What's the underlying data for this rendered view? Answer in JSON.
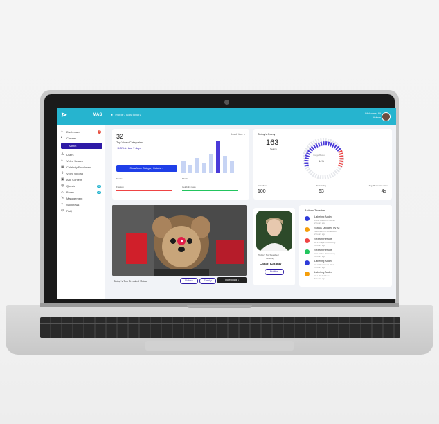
{
  "header": {
    "logo_glyph": "⋗",
    "brand": "MAS",
    "breadcrumb": "■  |  Home  /  Dashboard",
    "user_name": "Welcome, Ali",
    "user_role": "Admin"
  },
  "sidebar": {
    "items": [
      {
        "label": "Dashboard",
        "icon": "home-icon",
        "glyph": "⌂",
        "badge": "2"
      },
      {
        "label": "Classes",
        "icon": "dot-icon",
        "glyph": "•"
      },
      {
        "label": "Admin",
        "icon": "dot-icon",
        "glyph": "•",
        "active": true
      },
      {
        "label": "Users",
        "icon": "user-icon",
        "glyph": "♙"
      },
      {
        "label": "Video Search",
        "icon": "search-icon",
        "glyph": "⌕"
      },
      {
        "label": "Celebrity Enrollment",
        "icon": "grid-icon",
        "glyph": "▦"
      },
      {
        "label": "Video Upload",
        "icon": "upload-icon",
        "glyph": "⇪"
      },
      {
        "label": "Add Content",
        "icon": "add-icon",
        "glyph": "▣"
      },
      {
        "label": "Quests",
        "icon": "clock-icon",
        "glyph": "◷",
        "pill": "9"
      },
      {
        "label": "Boxes",
        "icon": "warning-icon",
        "glyph": "△",
        "pill": "4"
      },
      {
        "label": "Management",
        "icon": "pen-icon",
        "glyph": "✎"
      },
      {
        "label": "Workflows",
        "icon": "flow-icon",
        "glyph": "⟡"
      },
      {
        "label": "FAQ",
        "icon": "help-icon",
        "glyph": "⊙"
      }
    ]
  },
  "top_card": {
    "count": "32",
    "title": "Top Video Categories",
    "growth": "+4.3% in last 7 days",
    "range": "Last Year ▾",
    "button": "Show More Category Details  →",
    "legend": [
      "Sports",
      "Shorts",
      "Fashion",
      "Celebrity news"
    ],
    "legend_colors": [
      "#4b3bd9",
      "#f59e0b",
      "#ef4444",
      "#22c55e"
    ],
    "bar_levels": [
      0.35,
      0.25,
      0.45,
      0.3,
      0.55,
      0.95,
      0.5,
      0.35
    ]
  },
  "queries": {
    "title": "Today's Query",
    "value": "163",
    "value_sub": "Search",
    "gauge_label": "Image Based",
    "gauge_value": "64%",
    "stats": [
      {
        "label": "Scheduled",
        "value": "100"
      },
      {
        "label": "Processing",
        "value": "63"
      },
      {
        "label": "Avg. Response Time",
        "value": "4s"
      }
    ]
  },
  "video": {
    "caption": "Today's Top Trended Video",
    "tags": [
      "Nature",
      "Family"
    ],
    "download": "Download  ⤓"
  },
  "person": {
    "caption_1": "Today's Top Searched",
    "caption_2": "Celebrity",
    "name": "Canan Karatay",
    "tag": "Politics"
  },
  "timeline": {
    "title": "Actions Timeline",
    "items": [
      {
        "title": "Labeling Added",
        "sub": "Label Added by Admin",
        "time": "2 hours ago",
        "color": "#2e3bd9"
      },
      {
        "title": "Status Updated by Ali",
        "sub": "Submitted to Moderation",
        "time": "2 hours ago",
        "color": "#f59e0b"
      },
      {
        "title": "Search Results",
        "sub": "Ali's Image Processing",
        "time": "4 hours ago",
        "color": "#ef4444"
      },
      {
        "title": "Search Results",
        "sub": "Ali's Video Processing",
        "time": "4 hours ago",
        "color": "#22c55e"
      },
      {
        "title": "Labeling Added",
        "sub": "Ali Added New Label",
        "time": "5 hours ago",
        "color": "#2e3bd9"
      },
      {
        "title": "Labeling Added",
        "sub": "Ali Labeled Item",
        "time": "6 hours ago",
        "color": "#f59e0b"
      }
    ]
  }
}
